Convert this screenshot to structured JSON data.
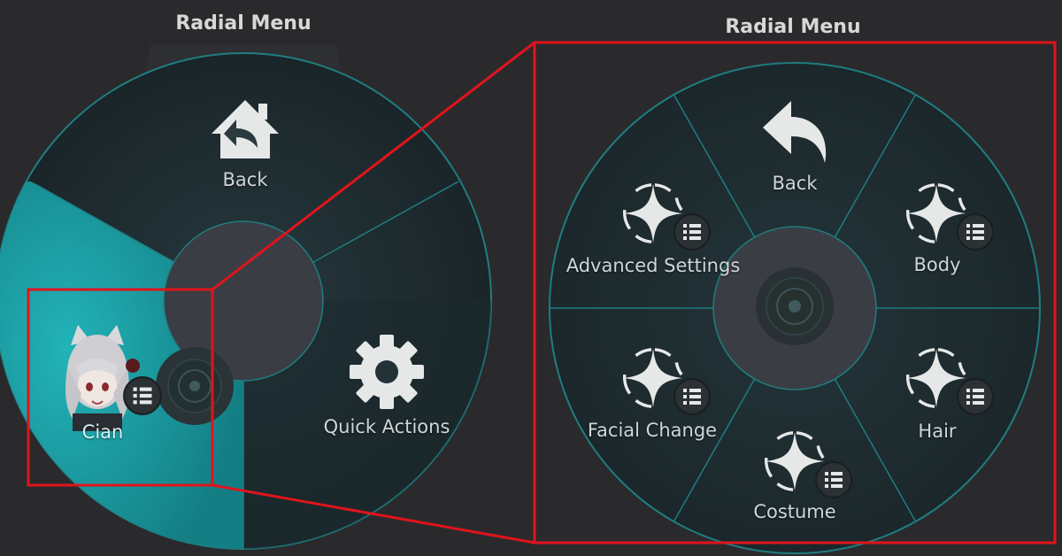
{
  "left_menu": {
    "title": "Radial Menu",
    "items": [
      {
        "label": "Back",
        "icon": "home-back-icon"
      },
      {
        "label": "Quick Actions",
        "icon": "gear-icon"
      },
      {
        "label": "Cian",
        "icon": "avatar-icon",
        "submenu": true
      }
    ]
  },
  "right_menu": {
    "title": "Radial Menu",
    "items": [
      {
        "label": "Back",
        "icon": "back-arrow-icon"
      },
      {
        "label": "Body",
        "icon": "sparkle-icon",
        "submenu": true
      },
      {
        "label": "Hair",
        "icon": "sparkle-icon",
        "submenu": true
      },
      {
        "label": "Costume",
        "icon": "sparkle-icon",
        "submenu": true
      },
      {
        "label": "Facial Change",
        "icon": "sparkle-icon",
        "submenu": true
      },
      {
        "label": "Advanced Settings",
        "icon": "sparkle-icon",
        "submenu": true
      }
    ]
  },
  "colors": {
    "background": "#2a2a2d",
    "menu_fill": "#1d2b30",
    "ring": "#1f7d80",
    "highlight": "#1e9aa0",
    "callout": "#e0141c"
  }
}
